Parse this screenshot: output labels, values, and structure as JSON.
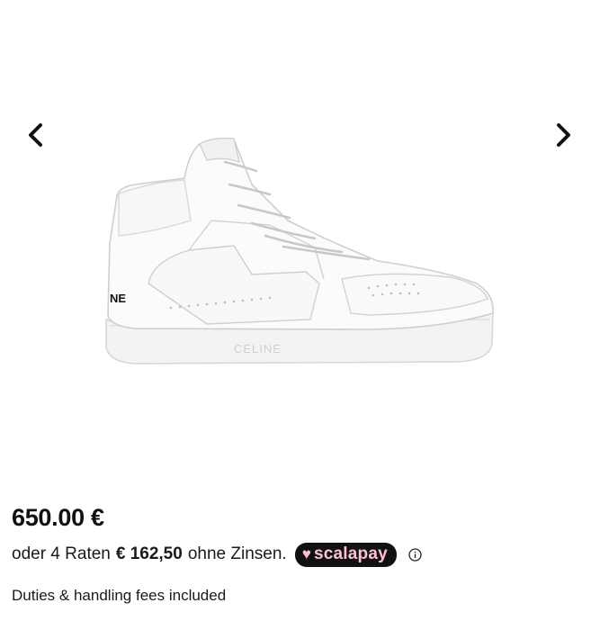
{
  "gallery": {
    "prev_icon": "chevron-left-icon",
    "next_icon": "chevron-right-icon",
    "image": {
      "brand_side": "NE",
      "brand_sole": "CELINE"
    }
  },
  "product": {
    "price": "650.00 €",
    "installments": {
      "prefix": "oder 4 Raten",
      "amount": "€ 162,50",
      "suffix": "ohne Zinsen.",
      "provider_label": "scalapay",
      "provider_icon": "heart-icon",
      "info_icon": "info-icon"
    },
    "duties_note": "Duties & handling fees included"
  },
  "colors": {
    "text": "#111111",
    "badge_bg": "#111111",
    "badge_text": "#ffc1d1"
  }
}
